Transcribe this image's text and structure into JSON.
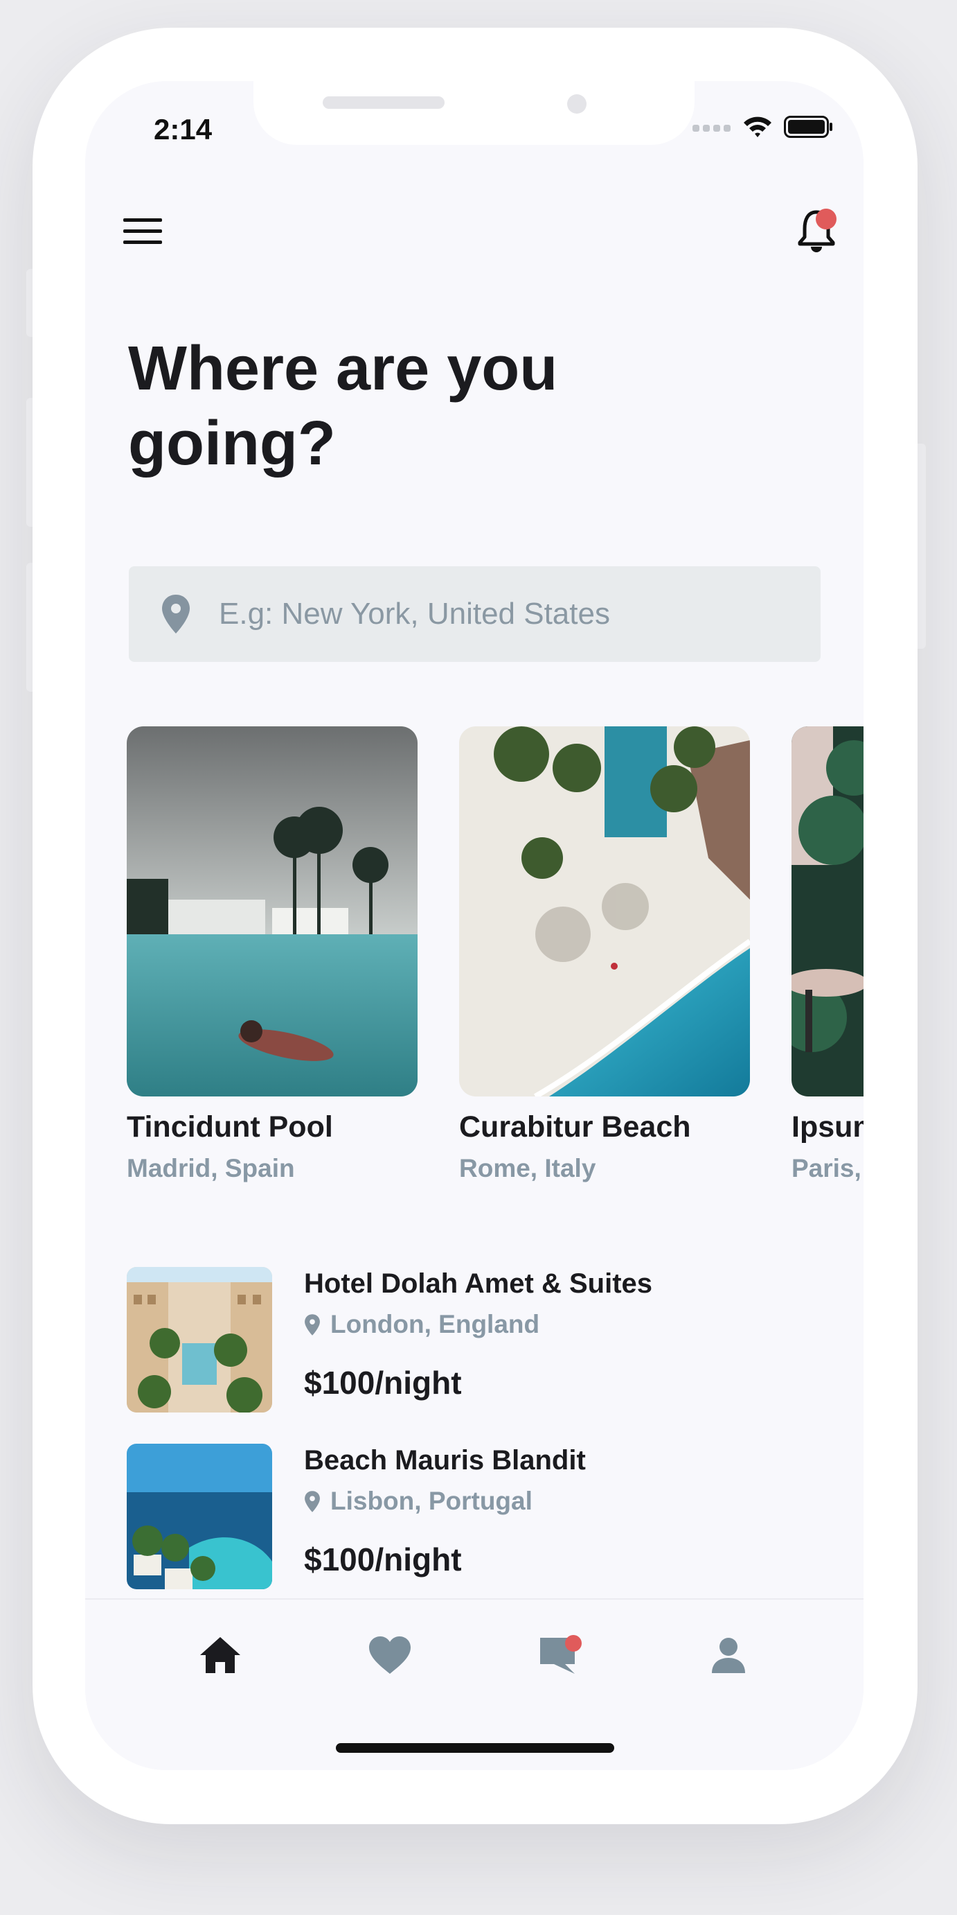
{
  "status_bar": {
    "time": "2:14"
  },
  "header": {
    "title": "Where are you going?"
  },
  "search": {
    "placeholder": "E.g: New York, United States"
  },
  "featured": [
    {
      "name": "Tincidunt Pool",
      "location": "Madrid, Spain",
      "image": "pool-photo"
    },
    {
      "name": "Curabitur Beach",
      "location": "Rome, Italy",
      "image": "beach-aerial-photo"
    },
    {
      "name": "Ipsum",
      "location": "Paris,",
      "image": "garden-terrace-photo"
    }
  ],
  "hotels": [
    {
      "name": "Hotel Dolah Amet & Suites",
      "location": "London, England",
      "price": "$100/night",
      "image": "hotel-courtyard-photo"
    },
    {
      "name": "Beach Mauris Blandit",
      "location": "Lisbon, Portugal",
      "price": "$100/night",
      "image": "coastal-resort-photo"
    }
  ],
  "tabbar": [
    {
      "icon": "home-icon",
      "active": true
    },
    {
      "icon": "heart-icon",
      "active": false
    },
    {
      "icon": "chat-icon",
      "active": false,
      "badge": true
    },
    {
      "icon": "user-icon",
      "active": false
    }
  ],
  "colors": {
    "accent_red": "#e05b5b",
    "muted": "#8898a5",
    "text": "#1b1b1f",
    "background": "#f8f8fc"
  }
}
